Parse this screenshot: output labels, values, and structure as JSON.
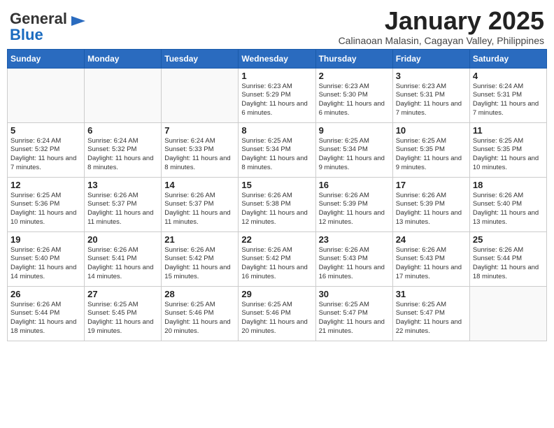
{
  "header": {
    "logo_general": "General",
    "logo_blue": "Blue",
    "month_year": "January 2025",
    "subtitle": "Calinaoan Malasin, Cagayan Valley, Philippines"
  },
  "days_of_week": [
    "Sunday",
    "Monday",
    "Tuesday",
    "Wednesday",
    "Thursday",
    "Friday",
    "Saturday"
  ],
  "weeks": [
    [
      {
        "day": "",
        "content": ""
      },
      {
        "day": "",
        "content": ""
      },
      {
        "day": "",
        "content": ""
      },
      {
        "day": "1",
        "content": "Sunrise: 6:23 AM\nSunset: 5:29 PM\nDaylight: 11 hours and 6 minutes."
      },
      {
        "day": "2",
        "content": "Sunrise: 6:23 AM\nSunset: 5:30 PM\nDaylight: 11 hours and 6 minutes."
      },
      {
        "day": "3",
        "content": "Sunrise: 6:23 AM\nSunset: 5:31 PM\nDaylight: 11 hours and 7 minutes."
      },
      {
        "day": "4",
        "content": "Sunrise: 6:24 AM\nSunset: 5:31 PM\nDaylight: 11 hours and 7 minutes."
      }
    ],
    [
      {
        "day": "5",
        "content": "Sunrise: 6:24 AM\nSunset: 5:32 PM\nDaylight: 11 hours and 7 minutes."
      },
      {
        "day": "6",
        "content": "Sunrise: 6:24 AM\nSunset: 5:32 PM\nDaylight: 11 hours and 8 minutes."
      },
      {
        "day": "7",
        "content": "Sunrise: 6:24 AM\nSunset: 5:33 PM\nDaylight: 11 hours and 8 minutes."
      },
      {
        "day": "8",
        "content": "Sunrise: 6:25 AM\nSunset: 5:34 PM\nDaylight: 11 hours and 8 minutes."
      },
      {
        "day": "9",
        "content": "Sunrise: 6:25 AM\nSunset: 5:34 PM\nDaylight: 11 hours and 9 minutes."
      },
      {
        "day": "10",
        "content": "Sunrise: 6:25 AM\nSunset: 5:35 PM\nDaylight: 11 hours and 9 minutes."
      },
      {
        "day": "11",
        "content": "Sunrise: 6:25 AM\nSunset: 5:35 PM\nDaylight: 11 hours and 10 minutes."
      }
    ],
    [
      {
        "day": "12",
        "content": "Sunrise: 6:25 AM\nSunset: 5:36 PM\nDaylight: 11 hours and 10 minutes."
      },
      {
        "day": "13",
        "content": "Sunrise: 6:26 AM\nSunset: 5:37 PM\nDaylight: 11 hours and 11 minutes."
      },
      {
        "day": "14",
        "content": "Sunrise: 6:26 AM\nSunset: 5:37 PM\nDaylight: 11 hours and 11 minutes."
      },
      {
        "day": "15",
        "content": "Sunrise: 6:26 AM\nSunset: 5:38 PM\nDaylight: 11 hours and 12 minutes."
      },
      {
        "day": "16",
        "content": "Sunrise: 6:26 AM\nSunset: 5:39 PM\nDaylight: 11 hours and 12 minutes."
      },
      {
        "day": "17",
        "content": "Sunrise: 6:26 AM\nSunset: 5:39 PM\nDaylight: 11 hours and 13 minutes."
      },
      {
        "day": "18",
        "content": "Sunrise: 6:26 AM\nSunset: 5:40 PM\nDaylight: 11 hours and 13 minutes."
      }
    ],
    [
      {
        "day": "19",
        "content": "Sunrise: 6:26 AM\nSunset: 5:40 PM\nDaylight: 11 hours and 14 minutes."
      },
      {
        "day": "20",
        "content": "Sunrise: 6:26 AM\nSunset: 5:41 PM\nDaylight: 11 hours and 14 minutes."
      },
      {
        "day": "21",
        "content": "Sunrise: 6:26 AM\nSunset: 5:42 PM\nDaylight: 11 hours and 15 minutes."
      },
      {
        "day": "22",
        "content": "Sunrise: 6:26 AM\nSunset: 5:42 PM\nDaylight: 11 hours and 16 minutes."
      },
      {
        "day": "23",
        "content": "Sunrise: 6:26 AM\nSunset: 5:43 PM\nDaylight: 11 hours and 16 minutes."
      },
      {
        "day": "24",
        "content": "Sunrise: 6:26 AM\nSunset: 5:43 PM\nDaylight: 11 hours and 17 minutes."
      },
      {
        "day": "25",
        "content": "Sunrise: 6:26 AM\nSunset: 5:44 PM\nDaylight: 11 hours and 18 minutes."
      }
    ],
    [
      {
        "day": "26",
        "content": "Sunrise: 6:26 AM\nSunset: 5:44 PM\nDaylight: 11 hours and 18 minutes."
      },
      {
        "day": "27",
        "content": "Sunrise: 6:25 AM\nSunset: 5:45 PM\nDaylight: 11 hours and 19 minutes."
      },
      {
        "day": "28",
        "content": "Sunrise: 6:25 AM\nSunset: 5:46 PM\nDaylight: 11 hours and 20 minutes."
      },
      {
        "day": "29",
        "content": "Sunrise: 6:25 AM\nSunset: 5:46 PM\nDaylight: 11 hours and 20 minutes."
      },
      {
        "day": "30",
        "content": "Sunrise: 6:25 AM\nSunset: 5:47 PM\nDaylight: 11 hours and 21 minutes."
      },
      {
        "day": "31",
        "content": "Sunrise: 6:25 AM\nSunset: 5:47 PM\nDaylight: 11 hours and 22 minutes."
      },
      {
        "day": "",
        "content": ""
      }
    ]
  ]
}
